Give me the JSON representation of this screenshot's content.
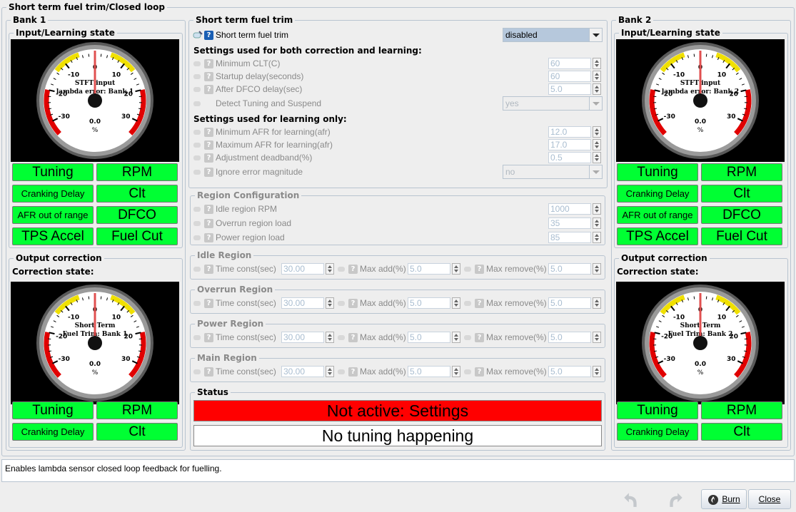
{
  "window_title": "Short term fuel trim/Closed loop",
  "bank1": {
    "title": "Bank 1",
    "input_state": "Input/Learning state",
    "gauge_in": {
      "label1": "STFT input",
      "label2": "lambda error: Bank 1",
      "value": "0.0",
      "unit": "%",
      "ticks": [
        "0",
        "-10",
        "10",
        "-20",
        "20",
        "-30",
        "30"
      ]
    },
    "indicators": [
      "Tuning",
      "RPM",
      "Cranking Delay",
      "Clt",
      "AFR out of range",
      "DFCO",
      "TPS Accel",
      "Fuel Cut"
    ],
    "output": "Output correction",
    "correction_state": "Correction state:",
    "gauge_out": {
      "label1": "Short Term",
      "label2": "Fuel Trim: Bank 1",
      "value": "0.0",
      "unit": "%",
      "ticks": [
        "0",
        "-10",
        "10",
        "-20",
        "20",
        "-30",
        "30"
      ]
    },
    "out_indicators": [
      "Tuning",
      "RPM",
      "Cranking Delay",
      "Clt"
    ]
  },
  "bank2": {
    "title": "Bank 2",
    "input_state": "Input/Learning state",
    "gauge_in": {
      "label1": "STFT input",
      "label2": "lambda error: Bank 2",
      "value": "0.0",
      "unit": "%",
      "ticks": [
        "0",
        "-10",
        "10",
        "-20",
        "20",
        "-30",
        "30"
      ]
    },
    "indicators": [
      "Tuning",
      "RPM",
      "Cranking Delay",
      "Clt",
      "AFR out of range",
      "DFCO",
      "TPS Accel",
      "Fuel Cut"
    ],
    "output": "Output correction",
    "correction_state": "Correction state:",
    "gauge_out": {
      "label1": "Short Term",
      "label2": "Fuel Trim: Bank 2",
      "value": "0.0",
      "unit": "%",
      "ticks": [
        "0",
        "-10",
        "10",
        "-20",
        "20",
        "-30",
        "30"
      ]
    },
    "out_indicators": [
      "Tuning",
      "RPM",
      "Cranking Delay",
      "Clt"
    ]
  },
  "stft": {
    "title": "Short term fuel trim",
    "enable_label": "Short term fuel trim",
    "enable_value": "disabled",
    "both_header": "Settings used for both correction and learning:",
    "min_clt_label": "Minimum CLT(C)",
    "min_clt": "60",
    "startup_label": "Startup delay(seconds)",
    "startup": "60",
    "dfco_label": "After DFCO delay(sec)",
    "dfco": "5.0",
    "detect_label": "Detect Tuning and Suspend",
    "detect": "yes",
    "learn_header": "Settings used for learning only:",
    "min_afr_label": "Minimum AFR for learning(afr)",
    "min_afr": "12.0",
    "max_afr_label": "Maximum AFR for learning(afr)",
    "max_afr": "17.0",
    "deadband_label": "Adjustment deadband(%)",
    "deadband": "0.5",
    "ignore_label": "Ignore error magnitude",
    "ignore": "no"
  },
  "region_config": {
    "title": "Region Configuration",
    "idle_rpm_label": "Idle region RPM",
    "idle_rpm": "1000",
    "overrun_label": "Overrun region load",
    "overrun": "35",
    "power_label": "Power region load",
    "power": "85"
  },
  "regions": [
    {
      "title": "Idle Region",
      "tc_label": "Time const(sec)",
      "tc": "30.00",
      "add_label": "Max add(%)",
      "add": "5.0",
      "rem_label": "Max remove(%)",
      "rem": "5.0"
    },
    {
      "title": "Overrun Region",
      "tc_label": "Time const(sec)",
      "tc": "30.00",
      "add_label": "Max add(%)",
      "add": "5.0",
      "rem_label": "Max remove(%)",
      "rem": "5.0"
    },
    {
      "title": "Power Region",
      "tc_label": "Time const(sec)",
      "tc": "30.00",
      "add_label": "Max add(%)",
      "add": "5.0",
      "rem_label": "Max remove(%)",
      "rem": "5.0"
    },
    {
      "title": "Main Region",
      "tc_label": "Time const(sec)",
      "tc": "30.00",
      "add_label": "Max add(%)",
      "add": "5.0",
      "rem_label": "Max remove(%)",
      "rem": "5.0"
    }
  ],
  "status": {
    "title": "Status",
    "line1": "Not active: Settings",
    "line2": "No tuning happening"
  },
  "help_text": "Enables lambda sensor closed loop feedback for fuelling.",
  "buttons": {
    "burn": "Burn",
    "close": "Close"
  },
  "colors": {
    "indicator_on": "#00ff33",
    "status_inactive": "#ff0000",
    "gauge_red": "#e00000",
    "gauge_yellow": "#f0e000"
  },
  "icons": [
    "undo-icon",
    "redo-icon",
    "burn-icon",
    "tuning-toggle-icon",
    "help-icon"
  ]
}
